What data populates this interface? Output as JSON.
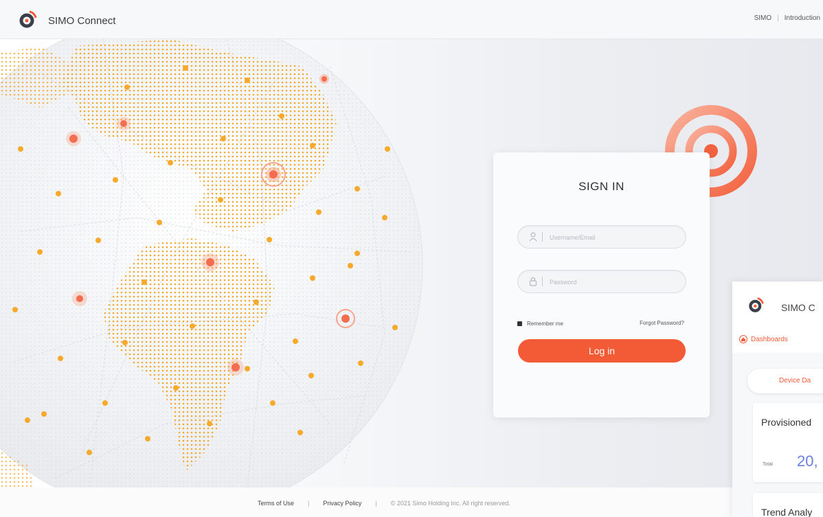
{
  "header": {
    "brand": "SIMO Connect",
    "nav": [
      "SIMO",
      "Introduction"
    ]
  },
  "signin": {
    "title": "SIGN IN",
    "username_placeholder": "Username/Email",
    "password_placeholder": "Password",
    "remember_label": "Remember me",
    "forgot_label": "Forgot Password?",
    "login_label": "Log in"
  },
  "footer": {
    "terms": "Terms of Use",
    "privacy": "Privacy Policy",
    "copyright": "© 2021 Simo Holding Inc. All right reserved."
  },
  "dashboard_preview": {
    "brand": "SIMO C",
    "tab": "Dashboards",
    "pill": "Device Da",
    "card_title": "Provisioned",
    "total_label": "Total",
    "total_value": "20,",
    "trend_title": "Trend Analy"
  },
  "colors": {
    "accent": "#f35a36",
    "dot": "#f5a623",
    "value_blue": "#6a7fe0"
  },
  "icons": {
    "logo": "simo-logo-icon",
    "user": "user-icon",
    "lock": "lock-icon",
    "signal": "signal-waves-icon",
    "home": "home-icon"
  }
}
